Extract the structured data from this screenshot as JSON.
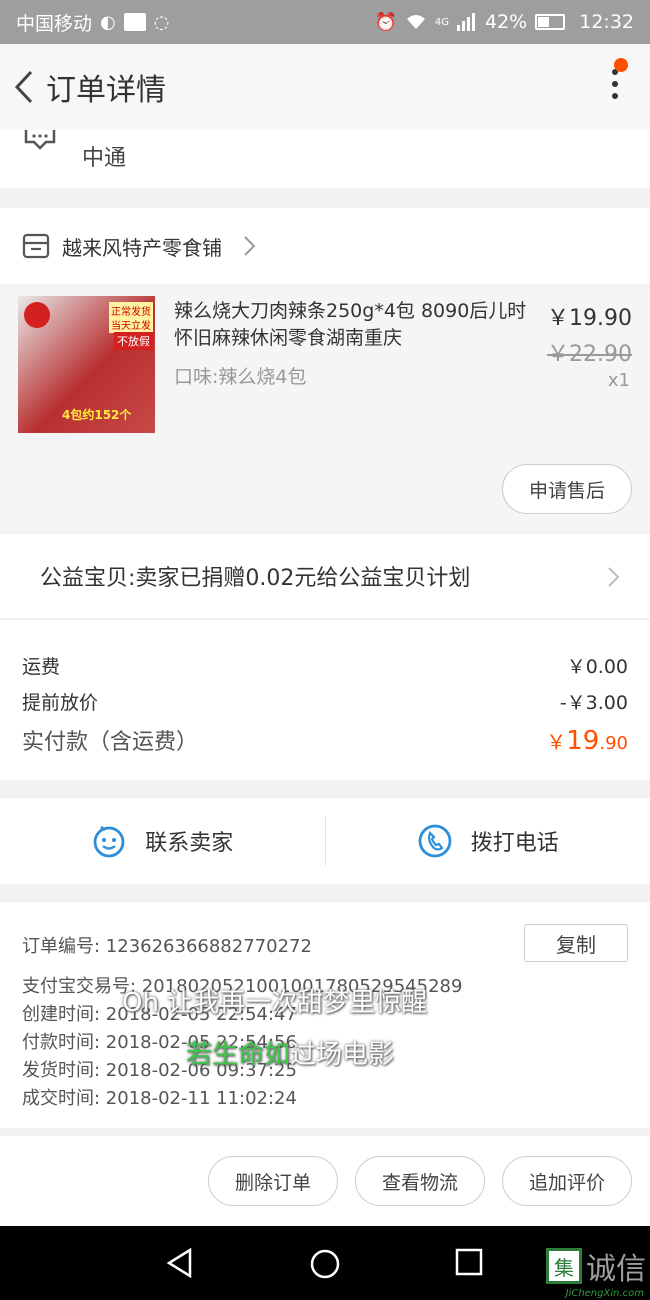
{
  "status_bar": {
    "carrier": "中国移动",
    "battery": "42%",
    "time": "12:32",
    "network": "4G"
  },
  "header": {
    "title": "订单详情"
  },
  "logistics": {
    "carrier": "中通"
  },
  "shop": {
    "name": "越来风特产零食铺"
  },
  "product": {
    "title": "辣么烧大刀肉辣条250g*4包 8090后儿时怀旧麻辣休闲零食湖南重庆",
    "variant": "口味:辣么烧4包",
    "price": "￥19.90",
    "original_price": "￥22.90",
    "quantity": "x1",
    "image_badge_1": "正常发货",
    "image_badge_2": "当天立发",
    "image_badge_3": "不放假",
    "image_caption": "4包约152个"
  },
  "after_sale_button": "申请售后",
  "charity": {
    "text": "公益宝贝:卖家已捐赠0.02元给公益宝贝计划"
  },
  "payment": {
    "shipping_label": "运费",
    "shipping_value": "￥0.00",
    "discount_label": "提前放价",
    "discount_value": "-￥3.00",
    "total_label": "实付款（含运费）",
    "total_currency": "￥",
    "total_integer": "19",
    "total_decimal": ".90"
  },
  "contact": {
    "seller_label": "联系卖家",
    "phone_label": "拨打电话"
  },
  "order_info": {
    "order_no": "订单编号:  1236263668827702​72",
    "copy_label": "复制",
    "alipay_no": "支付宝交易号:  2018020521001001780529545289",
    "created": "创建时间:  2018-02-05 22:54:47",
    "paid": "付款时间:  2018-02-05 22:54:56",
    "shipped": "发货时间:  2018-02-06 09:37:25",
    "completed": "成交时间:  2018-02-11 11:02:24"
  },
  "overlay": {
    "line1": "Oh 让我再一次甜梦里惊醒",
    "line2_highlight": "若生命如",
    "line2_rest": "过场电影"
  },
  "actions": {
    "delete": "删除订单",
    "logistics": "查看物流",
    "review": "追加评价"
  },
  "watermark": {
    "logo_char": "集",
    "text": "诚信",
    "sub": "JiChengXin.com"
  },
  "colors": {
    "accent": "#ff5000",
    "icon_blue": "#2b8fd9"
  }
}
